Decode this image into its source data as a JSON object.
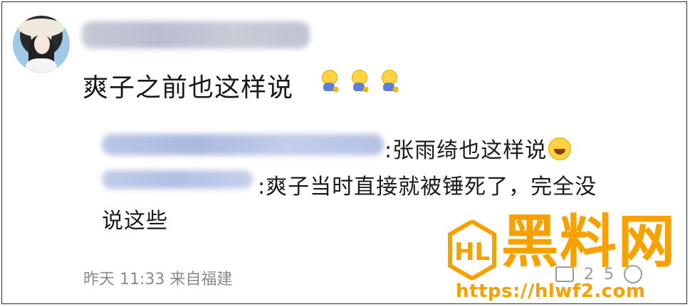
{
  "post": {
    "text": "爽子之前也这样说",
    "emoji_names": [
      "sweat-smile-emoji",
      "sweat-smile-emoji",
      "sweat-smile-emoji"
    ]
  },
  "replies": {
    "r1": ":张雨绮也这样说",
    "r2_line1": ":爽子当时直接就被锤死了，完全没",
    "r2_line2": "说这些"
  },
  "meta": {
    "time_source": "昨天 11:33 来自福建",
    "comment_count": "2",
    "like_count": "5"
  },
  "watermark": {
    "title": "黑料网",
    "url": "https://hlwf2.com"
  },
  "colors": {
    "accent": "#f6a100",
    "meta_text": "#8a8a8a"
  }
}
